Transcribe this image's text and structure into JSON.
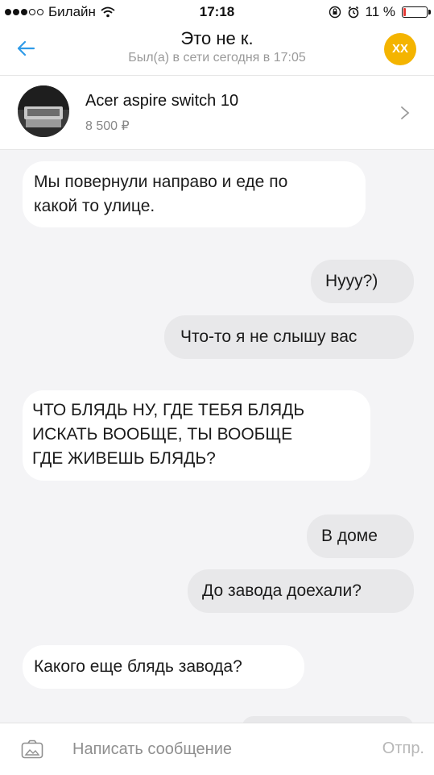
{
  "status_bar": {
    "carrier": "Билайн",
    "time": "17:18",
    "battery_percent": "11 %",
    "battery_level": 0.11,
    "battery_color": "#e53935"
  },
  "header": {
    "title": "Это не к.",
    "subtitle": "Был(а) в сети сегодня в 17:05",
    "avatar_initials": "XX",
    "avatar_color": "#f4b400"
  },
  "product": {
    "name": "Acer aspire switch 10",
    "price": "8 500 ₽"
  },
  "messages": [
    {
      "direction": "in",
      "lines": [
        "Мы повернули направо и еде по",
        "какой то улице."
      ]
    },
    {
      "direction": "out",
      "lines": [
        "Нууу?)"
      ]
    },
    {
      "direction": "out",
      "lines": [
        "Что-то я не слышу вас"
      ]
    },
    {
      "direction": "in",
      "lines": [
        "ЧТО БЛЯДЬ НУ, ГДЕ ТЕБЯ БЛЯДЬ",
        "ИСКАТЬ ВООБЩЕ, ТЫ ВООБЩЕ",
        "ГДЕ ЖИВЕШЬ БЛЯДЬ?"
      ]
    },
    {
      "direction": "out",
      "lines": [
        "В доме"
      ]
    },
    {
      "direction": "out",
      "lines": [
        "До завода доехали?"
      ]
    },
    {
      "direction": "in",
      "lines": [
        "Какого еще блядь завода?"
      ]
    }
  ],
  "composer": {
    "placeholder": "Написать сообщение",
    "send_label": "Отпр."
  },
  "icons": {
    "back": "arrow-left-icon",
    "camera": "camera-icon",
    "chevron": "chevron-right-icon",
    "wifi": "wifi-icon",
    "lock": "rotation-lock-icon",
    "alarm": "alarm-icon"
  },
  "colors": {
    "accent": "#2f9be8",
    "background": "#f4f4f6",
    "outgoing_bubble": "#e8e8ea",
    "incoming_bubble": "#ffffff"
  }
}
